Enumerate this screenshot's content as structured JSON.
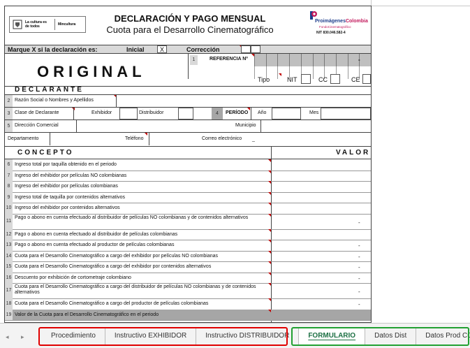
{
  "header": {
    "logo_left_text": "La cultura es de todos",
    "logo_left_text2": "Mincultura",
    "title": "DECLARACIÓN Y PAGO MENSUAL",
    "subtitle": "Cuota para el Desarrollo Cinematográfico",
    "brand_a": "Proimágenes",
    "brand_b": "Colombia",
    "brand_sub": "FondoCinematográfico",
    "nit": "NIT 830.046.582-4"
  },
  "marque": {
    "label": "Marque X si la declaración es:",
    "inicial": "Inicial",
    "inicial_value": "X",
    "correccion": "Corrección"
  },
  "original": "ORIGINAL",
  "referencia": {
    "num": "1",
    "label": "REFERENCIA Nº",
    "dash": "-"
  },
  "tipo": {
    "label": "Tipo",
    "nit": "NIT",
    "cc": "CC",
    "ce": "CE"
  },
  "declarante": {
    "title": "DECLARANTE",
    "r2_num": "2",
    "r2_label": "Razón Social o Nombres y Apellidos",
    "r3_num": "3",
    "r3_label": "Clase de Declarante",
    "exhibidor": "Exhibidor",
    "distribuidor": "Distribuidor",
    "periodo_num": "4",
    "periodo": "PERÍODO",
    "anio": "Año",
    "mes": "Mes",
    "r5_num": "5",
    "r5_label": "Dirección Comercial",
    "municipio": "Municipio",
    "departamento": "Departamento",
    "telefono": "Teléfono",
    "correo": "Correo electrónico",
    "correo_value": "_"
  },
  "concepto": {
    "title": "CONCEPTO",
    "valor": "VALOR",
    "rows": [
      {
        "num": "6",
        "text": "Ingreso total por taquilla obtenido en el periodo",
        "value": ""
      },
      {
        "num": "7",
        "text": "Ingreso del exhibidor por películas NO colombianas",
        "value": ""
      },
      {
        "num": "8",
        "text": "Ingreso del exhibidor por películas colombianas",
        "value": ""
      },
      {
        "num": "9",
        "text": "Ingreso total de taquilla por contenidos alternativos",
        "value": ""
      },
      {
        "num": "10",
        "text": "Ingreso del exhibidor por contenidos alternativos",
        "value": ""
      },
      {
        "num": "11",
        "text": "Pago o abono en cuenta efectuado al distribuidor de películas NO colombianas y de contenidos alternativos",
        "value": "-"
      },
      {
        "num": "12",
        "text": "Pago o abono en cuenta efectuado al distribuidor de películas colombianas",
        "value": ""
      },
      {
        "num": "13",
        "text": "Pago o abono en cuenta efectuado al productor de películas colombianas",
        "value": "-"
      },
      {
        "num": "14",
        "text": "Cuota para el Desarrollo Cinematográfico a cargo del exhibidor por películas NO colombianas",
        "value": "-"
      },
      {
        "num": "15",
        "text": "Cuota para el Desarrollo Cinematográfico a cargo del exhibidor por contenidos alternativos",
        "value": "-"
      },
      {
        "num": "16",
        "text": "Descuento por exhibición de cortometraje colombiano",
        "value": "-"
      },
      {
        "num": "17",
        "text": "Cuota para el Desarrollo Cinematográfico a cargo del distribuidor de películas NO colombianas y de contenidos alternativos",
        "value": "-"
      },
      {
        "num": "18",
        "text": "Cuota para el Desarrollo Cinematográfico a cargo del productor de películas colombianas",
        "value": "-"
      },
      {
        "num": "19",
        "text": "Valor de la Cuota para el Desarrollo Cinematográfico en el periodo",
        "value": ""
      }
    ]
  },
  "tabs": [
    {
      "label": "Procedimiento"
    },
    {
      "label": "Instructivo EXHIBIDOR"
    },
    {
      "label": "Instructivo DISTRIBUIDOR"
    },
    {
      "label": "FORMULARIO",
      "active": true
    },
    {
      "label": "Datos Dist"
    },
    {
      "label": "Datos Prod COL"
    }
  ],
  "nav": {
    "prev": "◂",
    "next": "▸"
  },
  "colors": {
    "active_tab": "#1e7145",
    "highlight_red": "#e00000",
    "highlight_green": "#22a032",
    "brand_blue": "#1f3e8c",
    "brand_magenta": "#c2185b"
  }
}
